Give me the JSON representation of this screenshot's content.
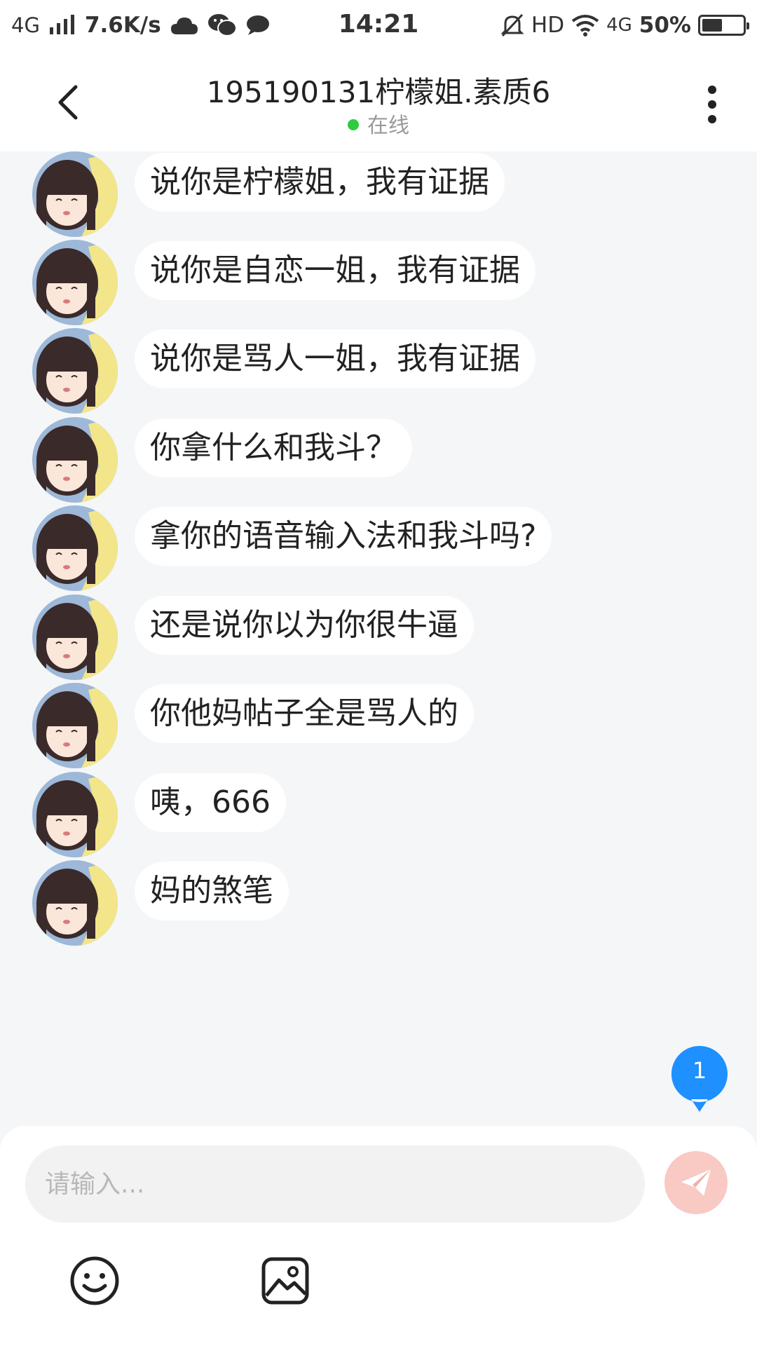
{
  "status_bar": {
    "network_left": "4G",
    "speed": "7.6K/s",
    "time": "14:21",
    "hd": "HD",
    "network_right": "4G",
    "battery_text": "50%",
    "battery_level": 0.5,
    "icons": [
      "signal-icon",
      "cloud-icon",
      "wechat-icon",
      "chat-bubble-icon",
      "mute-bell-icon",
      "wifi-icon",
      "battery-icon"
    ]
  },
  "header": {
    "title": "195190131柠檬姐.素质6",
    "status": "在线",
    "status_color": "#2ecc40"
  },
  "messages": [
    {
      "text": "说你是柠檬姐，我有证据"
    },
    {
      "text": "说你是自恋一姐，我有证据"
    },
    {
      "text": "说你是骂人一姐，我有证据"
    },
    {
      "text": "你拿什么和我斗？"
    },
    {
      "text": "拿你的语音输入法和我斗吗?"
    },
    {
      "text": "还是说你以为你很牛逼"
    },
    {
      "text": "你他妈帖子全是骂人的"
    },
    {
      "text": "咦，666"
    },
    {
      "text": "妈的煞笔"
    }
  ],
  "unread": {
    "count": "1",
    "color": "#1e90ff"
  },
  "composer": {
    "placeholder": "请输入...",
    "send_color": "#f9c9c4"
  }
}
